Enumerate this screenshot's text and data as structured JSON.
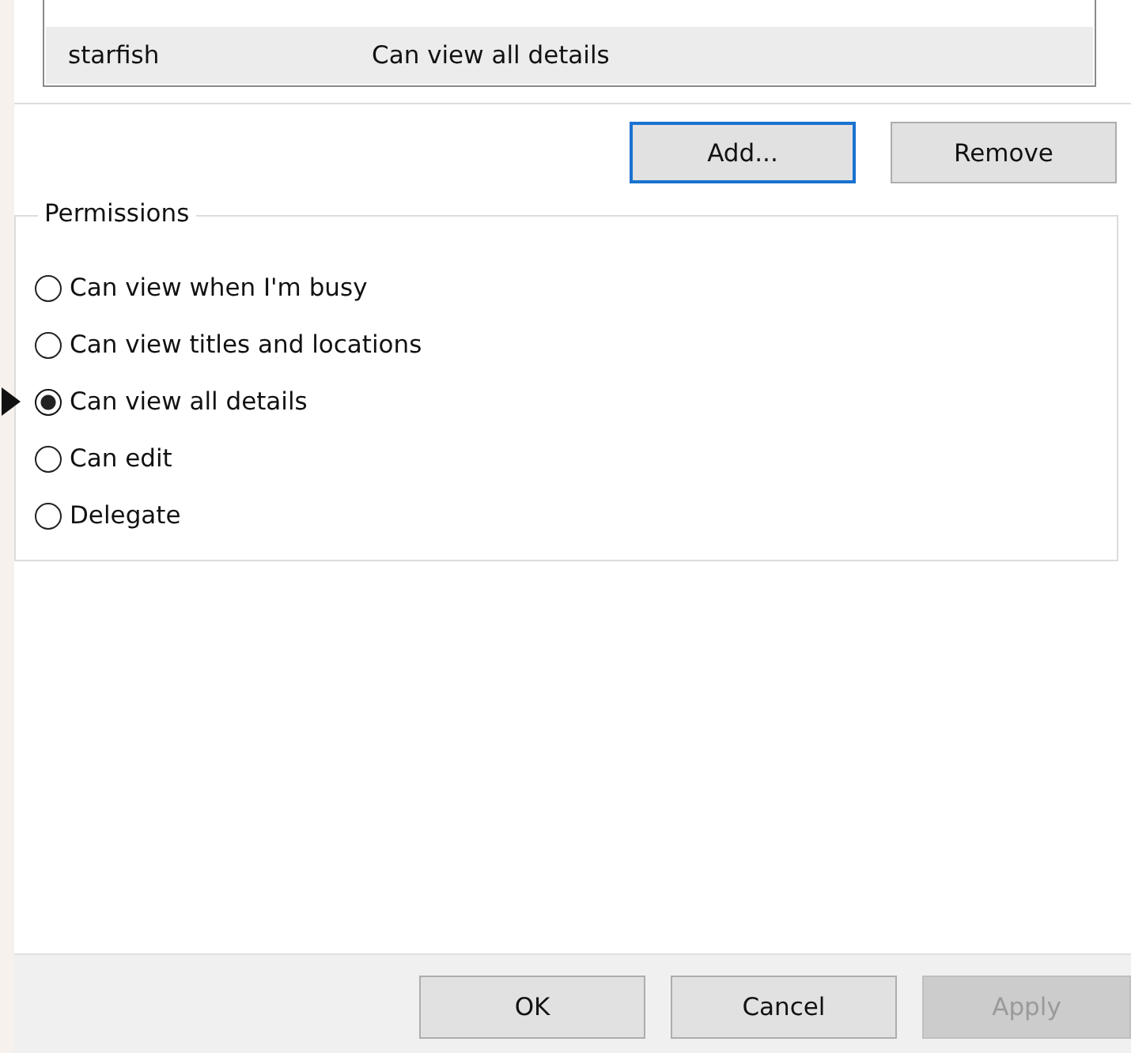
{
  "permission_list": {
    "rows": [
      {
        "name": "starfish",
        "permission": "Can view all details",
        "selected": true
      }
    ]
  },
  "list_buttons": [
    {
      "label": "Add...",
      "focused": true
    },
    {
      "label": "Remove",
      "focused": false
    }
  ],
  "permissions": {
    "title": "Permissions",
    "options": [
      {
        "label": "Can view when I'm busy",
        "selected": false
      },
      {
        "label": "Can view titles and locations",
        "selected": false
      },
      {
        "label": "Can view all details",
        "selected": true,
        "pointer": true
      },
      {
        "label": "Can edit",
        "selected": false
      },
      {
        "label": "Delegate",
        "selected": false
      }
    ]
  },
  "footer_buttons": [
    {
      "label": "OK",
      "disabled": false
    },
    {
      "label": "Cancel",
      "disabled": false
    },
    {
      "label": "Apply",
      "disabled": true
    }
  ]
}
